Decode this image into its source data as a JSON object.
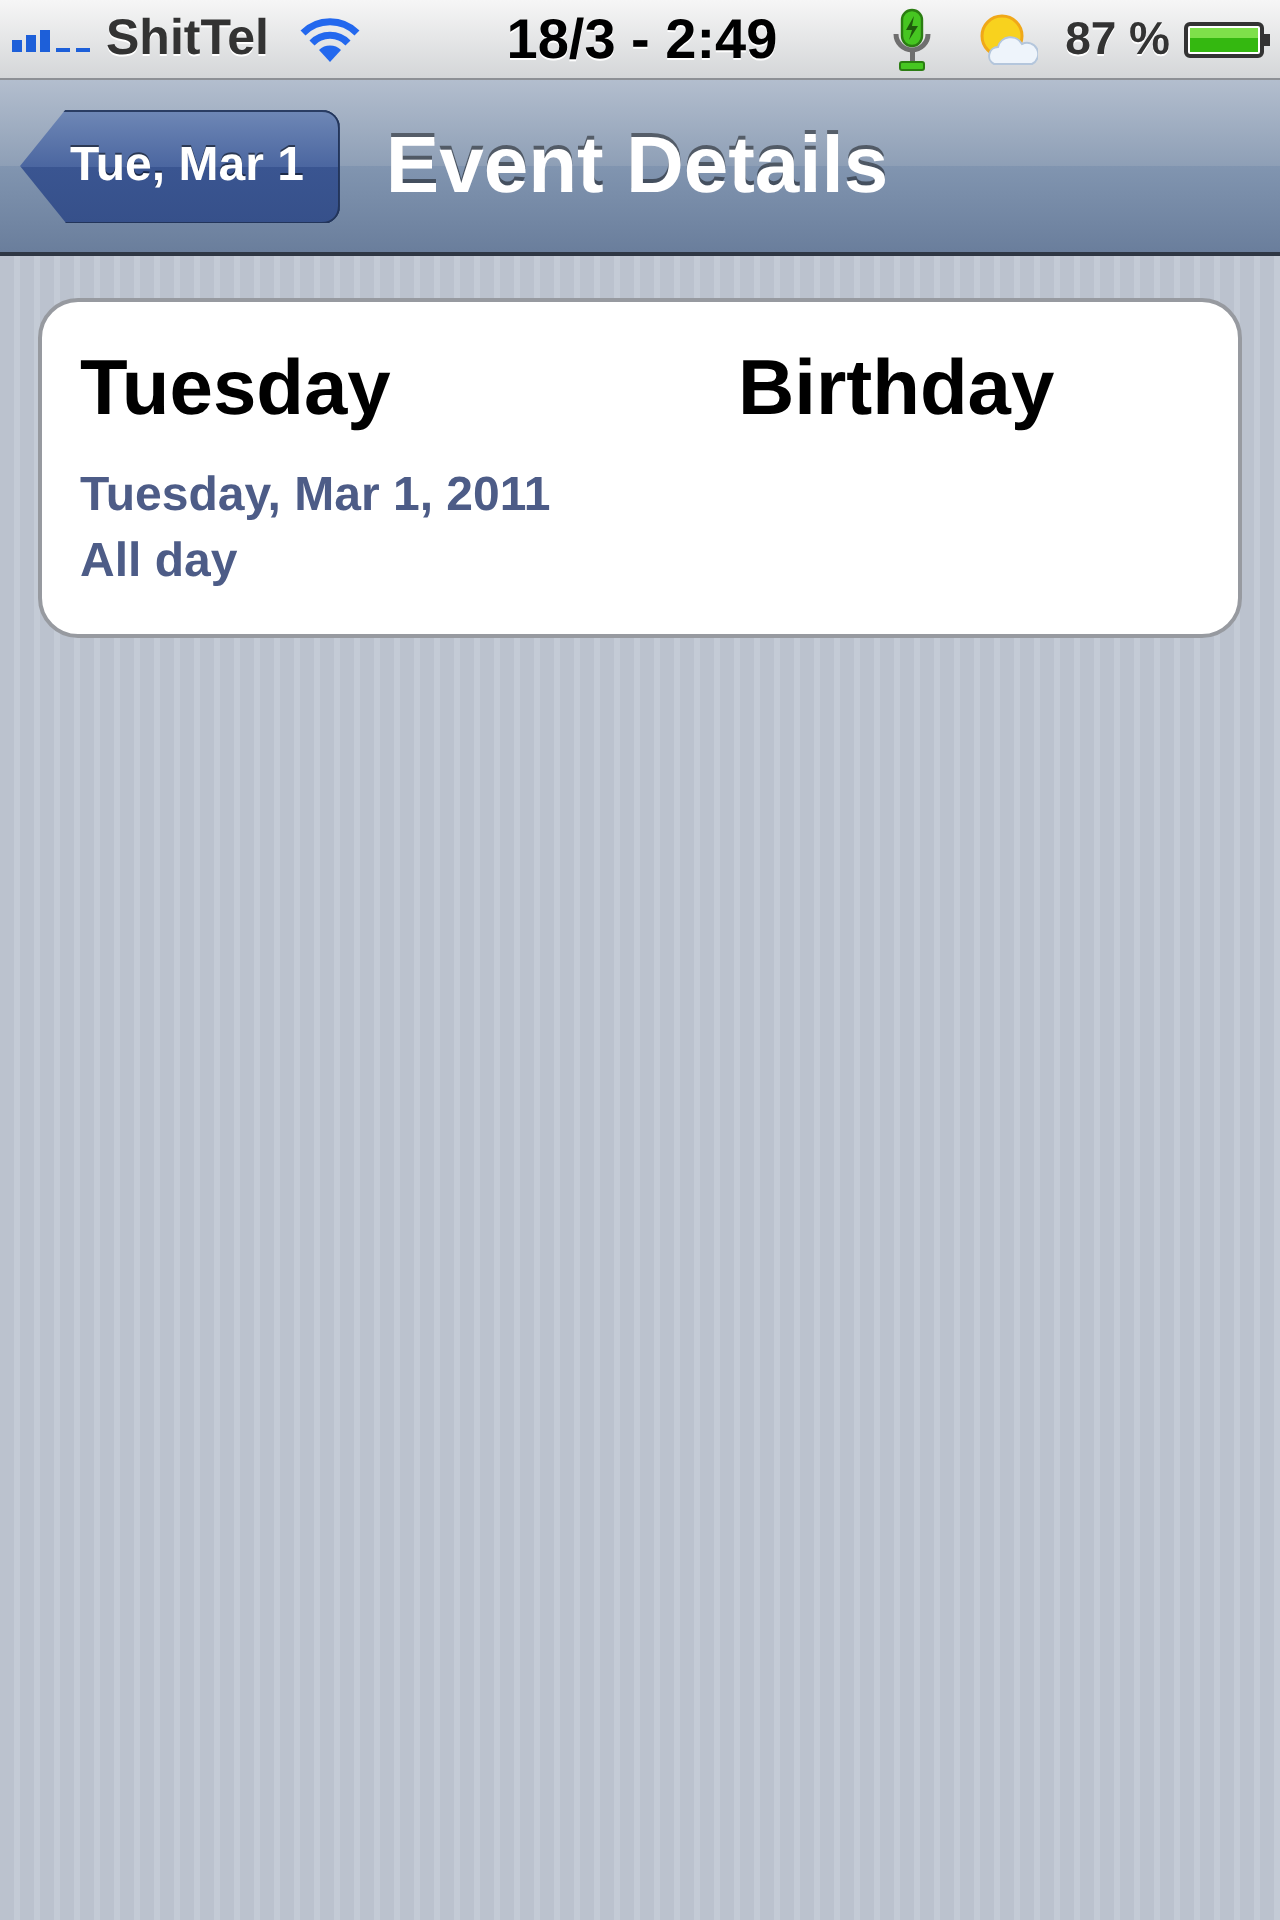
{
  "status_bar": {
    "carrier": "ShitTel",
    "time": "18/3 - 2:49",
    "battery_percent": "87 %"
  },
  "nav_bar": {
    "back_button": "Tue, Mar 1",
    "title": "Event Details"
  },
  "event": {
    "title_words": [
      "Tuesday",
      "Birthday"
    ],
    "date": "Tuesday, Mar 1, 2011",
    "time": "All day"
  }
}
